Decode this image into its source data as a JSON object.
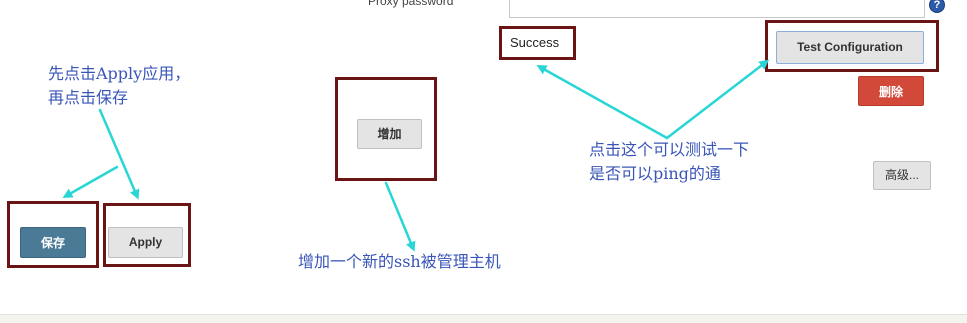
{
  "proxy": {
    "password_label": "Proxy password",
    "help_glyph": "?"
  },
  "status": {
    "success_text": "Success"
  },
  "buttons": {
    "test_configuration": "Test Configuration",
    "delete": "删除",
    "advanced": "高级...",
    "add": "增加",
    "save": "保存",
    "apply": "Apply"
  },
  "annotations": {
    "save_apply_line1": "先点击Apply应用，",
    "save_apply_line2": "再点击保存",
    "test_line1": "点击这个可以测试一下",
    "test_line2": "是否可以ping的通",
    "add_host": "增加一个新的ssh被管理主机"
  },
  "colors": {
    "highlight_box": "#6b1416",
    "arrow": "#28d6d6",
    "annotation_text": "#3a55b8",
    "delete_button": "#d24939",
    "save_button": "#4a7a96"
  }
}
